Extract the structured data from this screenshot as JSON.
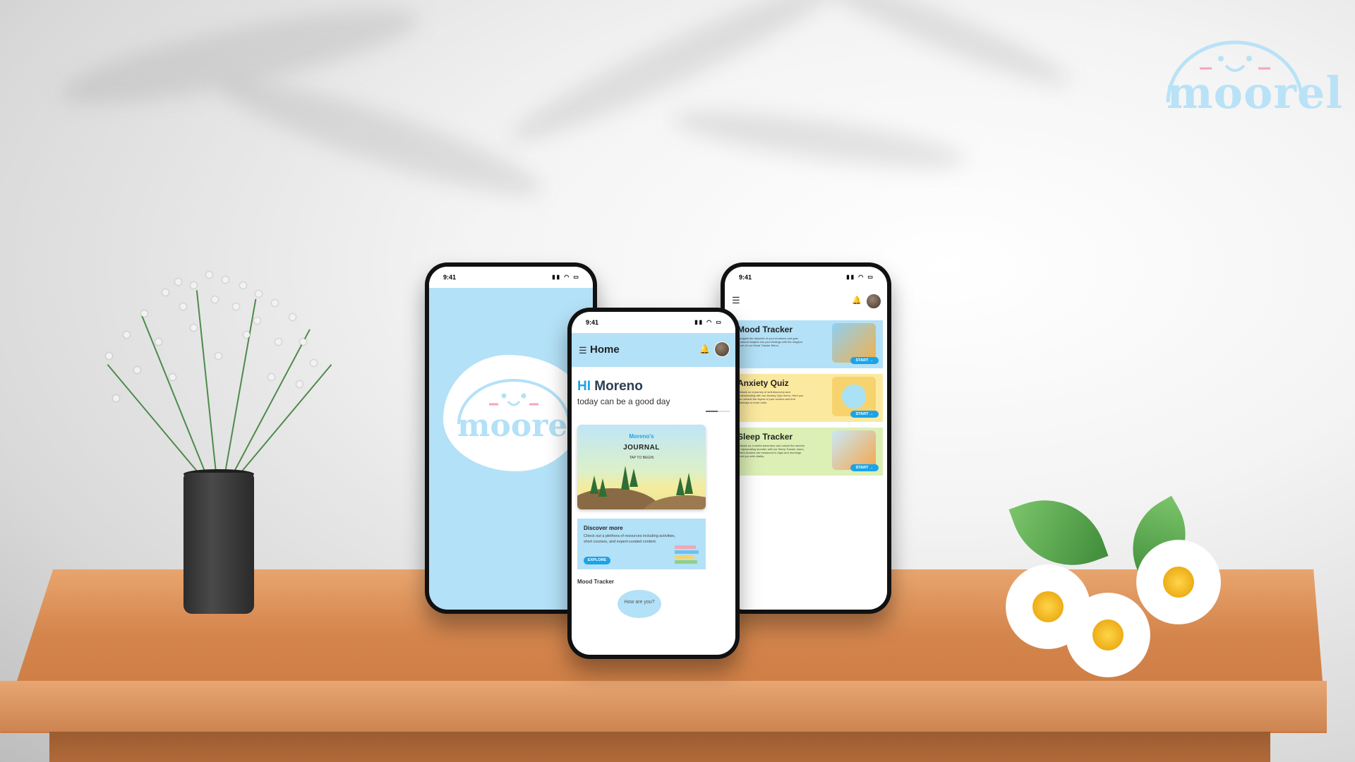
{
  "brand": {
    "name": "moorel",
    "colors": {
      "primary": "#b3e1f7",
      "accent": "#1aa4e8"
    }
  },
  "splash_phone": {
    "time": "9:41",
    "logo_text": "moorel"
  },
  "home_phone": {
    "time": "9:41",
    "header": {
      "title": "Home",
      "menu_icon": "hamburger-icon",
      "bell_icon": "bell-icon"
    },
    "greeting": {
      "hi": "HI",
      "name": "Moreno",
      "subtitle": "today can be a good day"
    },
    "journal": {
      "owner": "Moreno's",
      "title": "JOURNAL",
      "cta": "TAP TO BEGIN"
    },
    "discover": {
      "title": "Discover more",
      "body": "Check out a plethora of resources including activities, short courses, and expert-curated content.",
      "button": "EXPLORE"
    },
    "mood_tracker_label": "Mood Tracker",
    "mood_prompt": "How are you?",
    "progress": 0.5
  },
  "features_phone": {
    "time": "9:41",
    "cards": [
      {
        "title": "Mood Tracker",
        "body": "Navigate the labyrinth of your emotions and gain profound insights into your feelings with the magical touch of our Mood Tracker Menu.",
        "button": "START",
        "color": "#b3e1f7"
      },
      {
        "title": "Anxiety Quiz",
        "body": "Embark on a journey of self-discovery and understanding with our Anxiety Quiz menu. Here you can unravel the layers of your worries and find pathways to inner calm.",
        "button": "START",
        "color": "#fbe9a0"
      },
      {
        "title": "Sleep Tracker",
        "body": "Embark on a restful adventure and unlock the secrets of rejuvenating slumber with our Sleep Tracker menu, where dreams are measured in days and mornings greet you with vitality.",
        "button": "START",
        "color": "#dcefb4"
      }
    ]
  }
}
